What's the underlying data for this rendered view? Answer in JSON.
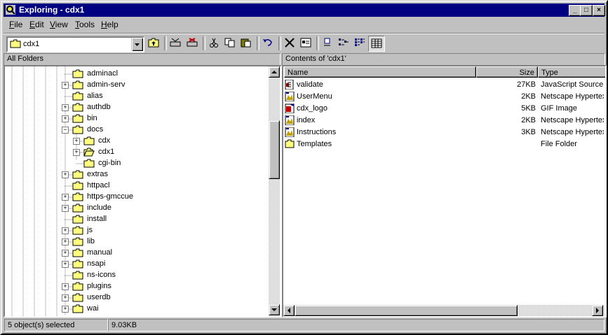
{
  "window": {
    "title": "Exploring - cdx1"
  },
  "menu": [
    {
      "label": "File",
      "key": "F",
      "rest": "ile"
    },
    {
      "label": "Edit",
      "key": "E",
      "rest": "dit"
    },
    {
      "label": "View",
      "key": "V",
      "rest": "iew"
    },
    {
      "label": "Tools",
      "key": "T",
      "rest": "ools"
    },
    {
      "label": "Help",
      "key": "H",
      "rest": "elp"
    }
  ],
  "toolbar": {
    "address": "cdx1",
    "buttons": [
      "up-one-level-icon",
      "map-drive-icon",
      "disconnect-drive-icon",
      "cut-icon",
      "copy-icon",
      "paste-icon",
      "undo-icon",
      "delete-icon",
      "properties-icon",
      "large-icons-icon",
      "small-icons-icon",
      "list-icon",
      "details-icon"
    ]
  },
  "left_pane": {
    "header": "All Folders",
    "items": [
      {
        "label": "adminacl",
        "depth": 0,
        "expander": ""
      },
      {
        "label": "admin-serv",
        "depth": 0,
        "expander": "+"
      },
      {
        "label": "alias",
        "depth": 0,
        "expander": ""
      },
      {
        "label": "authdb",
        "depth": 0,
        "expander": "+"
      },
      {
        "label": "bin",
        "depth": 0,
        "expander": "+"
      },
      {
        "label": "docs",
        "depth": 0,
        "expander": "-"
      },
      {
        "label": "cdx",
        "depth": 1,
        "expander": "+"
      },
      {
        "label": "cdx1",
        "depth": 1,
        "expander": "+",
        "open": true
      },
      {
        "label": "cgi-bin",
        "depth": 1,
        "expander": ""
      },
      {
        "label": "extras",
        "depth": 0,
        "expander": "+"
      },
      {
        "label": "httpacl",
        "depth": 0,
        "expander": ""
      },
      {
        "label": "https-gmccue",
        "depth": 0,
        "expander": "+"
      },
      {
        "label": "include",
        "depth": 0,
        "expander": "+"
      },
      {
        "label": "install",
        "depth": 0,
        "expander": ""
      },
      {
        "label": "js",
        "depth": 0,
        "expander": "+"
      },
      {
        "label": "lib",
        "depth": 0,
        "expander": "+"
      },
      {
        "label": "manual",
        "depth": 0,
        "expander": "+"
      },
      {
        "label": "nsapi",
        "depth": 0,
        "expander": "+"
      },
      {
        "label": "ns-icons",
        "depth": 0,
        "expander": ""
      },
      {
        "label": "plugins",
        "depth": 0,
        "expander": "+"
      },
      {
        "label": "userdb",
        "depth": 0,
        "expander": "+"
      },
      {
        "label": "wai",
        "depth": 0,
        "expander": "+"
      }
    ]
  },
  "right_pane": {
    "header": "Contents of 'cdx1'",
    "columns": {
      "name": "Name",
      "size": "Size",
      "type": "Type"
    },
    "files": [
      {
        "name": "validate",
        "size": "27KB",
        "type": "JavaScript Source",
        "icon": "script-file-icon"
      },
      {
        "name": "UserMenu",
        "size": "2KB",
        "type": "Netscape Hypertext",
        "icon": "html-file-icon"
      },
      {
        "name": "cdx_logo",
        "size": "5KB",
        "type": "GIF Image",
        "icon": "gif-image-icon"
      },
      {
        "name": "index",
        "size": "2KB",
        "type": "Netscape Hypertext",
        "icon": "html-file-icon"
      },
      {
        "name": "Instructions",
        "size": "3KB",
        "type": "Netscape Hypertext",
        "icon": "html-file-icon"
      },
      {
        "name": "Templates",
        "size": "",
        "type": "File Folder",
        "icon": "folder-icon"
      }
    ]
  },
  "status": {
    "objects": "5 object(s) selected",
    "size": "9.03KB"
  },
  "colors": {
    "titlebar": "#000080",
    "face": "#c0c0c0",
    "folder": "#ffff80"
  }
}
